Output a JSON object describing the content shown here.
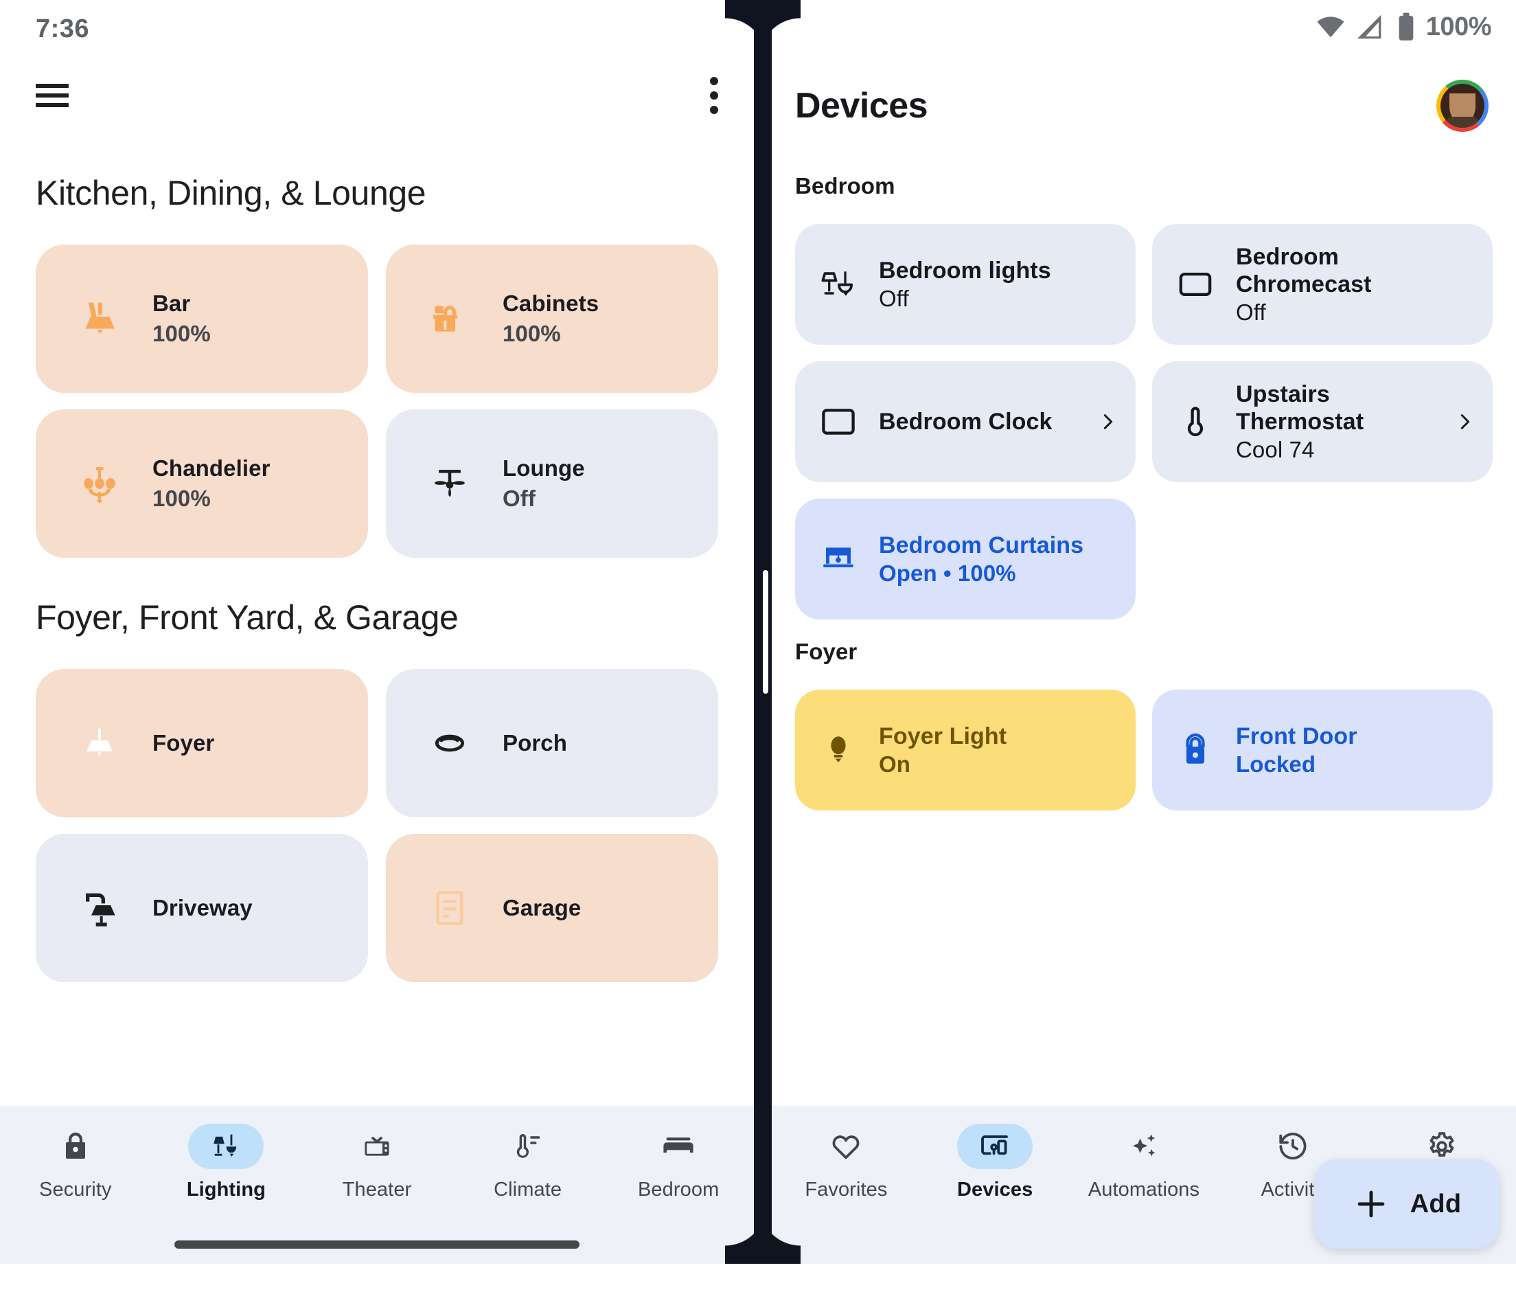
{
  "left": {
    "status": {
      "time": "7:36"
    },
    "header": {
      "menu_icon": "hamburger-menu-icon",
      "overflow_icon": "more-vert-icon"
    },
    "sections": [
      {
        "title": "Kitchen, Dining, & Lounge",
        "tiles": [
          {
            "name": "Bar",
            "state": "100%",
            "icon": "wall-sconce-icon",
            "on": true
          },
          {
            "name": "Cabinets",
            "state": "100%",
            "icon": "cabinet-light-icon",
            "on": true
          },
          {
            "name": "Chandelier",
            "state": "100%",
            "icon": "chandelier-icon",
            "on": true
          },
          {
            "name": "Lounge",
            "state": "Off",
            "icon": "ceiling-fan-icon",
            "on": false
          }
        ]
      },
      {
        "title": "Foyer, Front Yard, & Garage",
        "tiles": [
          {
            "name": "Foyer",
            "state": "",
            "icon": "pendant-light-icon",
            "on": true
          },
          {
            "name": "Porch",
            "state": "",
            "icon": "flush-mount-light-icon",
            "on": false
          },
          {
            "name": "Driveway",
            "state": "",
            "icon": "outdoor-lamp-icon",
            "on": false
          },
          {
            "name": "Garage",
            "state": "",
            "icon": "garage-icon",
            "on": true
          }
        ]
      }
    ],
    "nav": [
      {
        "label": "Security",
        "icon": "lock-icon",
        "active": false
      },
      {
        "label": "Lighting",
        "icon": "lamps-icon",
        "active": true
      },
      {
        "label": "Theater",
        "icon": "tv-icon",
        "active": false
      },
      {
        "label": "Climate",
        "icon": "thermostat-icon",
        "active": false
      },
      {
        "label": "Bedroom",
        "icon": "bed-icon",
        "active": false
      }
    ]
  },
  "right": {
    "status": {
      "battery": "100%",
      "wifi_icon": "wifi-icon",
      "signal_icon": "cell-signal-icon",
      "battery_icon": "battery-full-icon"
    },
    "header": {
      "title": "Devices",
      "avatar": "account-avatar"
    },
    "sections": [
      {
        "title": "Bedroom",
        "cards": [
          {
            "name": "Bedroom lights",
            "state": "Off",
            "icon": "lamps-icon",
            "style": "grey",
            "chevron": false
          },
          {
            "name": "Bedroom Chromecast",
            "state": "Off",
            "icon": "chromecast-icon",
            "style": "grey",
            "chevron": false
          },
          {
            "name": "Bedroom Clock",
            "state": "",
            "icon": "display-icon",
            "style": "grey",
            "chevron": true
          },
          {
            "name": "Upstairs Thermostat",
            "state": "Cool 74",
            "icon": "thermostat-icon",
            "style": "grey",
            "chevron": true
          },
          {
            "name": "Bedroom Curtains",
            "state": "Open • 100%",
            "icon": "curtains-icon",
            "style": "blue",
            "chevron": false
          }
        ]
      },
      {
        "title": "Foyer",
        "cards": [
          {
            "name": "Foyer Light",
            "state": "On",
            "icon": "bulb-icon",
            "style": "yellow",
            "chevron": false
          },
          {
            "name": "Front Door",
            "state": "Locked",
            "icon": "lock-icon",
            "style": "blue",
            "chevron": false
          }
        ]
      }
    ],
    "fab": {
      "label": "Add",
      "icon": "plus-icon"
    },
    "nav": [
      {
        "label": "Favorites",
        "icon": "heart-icon",
        "active": false
      },
      {
        "label": "Devices",
        "icon": "devices-icon",
        "active": true
      },
      {
        "label": "Automations",
        "icon": "sparkle-icon",
        "active": false
      },
      {
        "label": "Activity",
        "icon": "history-icon",
        "active": false
      },
      {
        "label": "Settings",
        "icon": "gear-icon",
        "active": false
      }
    ]
  },
  "colors": {
    "tile_on": "#f6ddcc",
    "tile_off": "#e8ebf4",
    "accent_orange": "#f9a95a",
    "accent_blue": "#1559d6",
    "card_blue": "#dae1fb",
    "card_yellow": "#fbdd79",
    "nav_bg": "#eef1f8",
    "nav_pill": "#bfe0fb"
  }
}
